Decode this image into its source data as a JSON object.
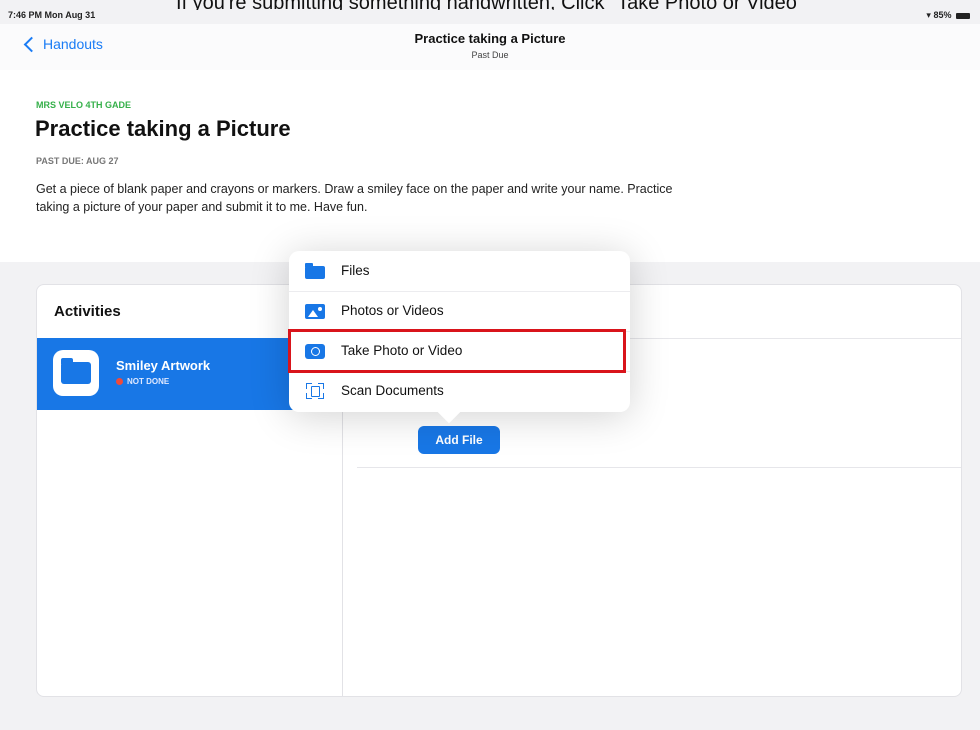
{
  "caption": "If you're submitting something handwritten, Click \"Take Photo or Video\"",
  "status_bar": {
    "time": "7:46 PM",
    "date": "Mon Aug 31",
    "battery": "85%"
  },
  "nav": {
    "back_label": "Handouts",
    "title": "Practice taking a Picture",
    "subtitle": "Past Due"
  },
  "assignment": {
    "class_name": "MRS VELO 4TH GADE",
    "title": "Practice taking a Picture",
    "due": "PAST DUE: AUG 27",
    "description": "Get a piece of blank paper and crayons or markers. Draw a smiley face on the paper and write your name. Practice taking a picture of your paper and submit it to me. Have fun."
  },
  "activities": {
    "header": "Activities",
    "items": [
      {
        "name": "Smiley Artwork",
        "status": "NOT DONE"
      }
    ]
  },
  "add_file_label": "Add File",
  "menu": {
    "items": [
      {
        "label": "Files",
        "icon": "folder-icon"
      },
      {
        "label": "Photos or Videos",
        "icon": "photo-icon"
      },
      {
        "label": "Take Photo or Video",
        "icon": "camera-icon"
      },
      {
        "label": "Scan Documents",
        "icon": "scan-icon"
      }
    ]
  },
  "colors": {
    "accent": "#1877e6",
    "class_green": "#35b04a",
    "highlight_red": "#d9141b",
    "status_red": "#f04a3a"
  }
}
